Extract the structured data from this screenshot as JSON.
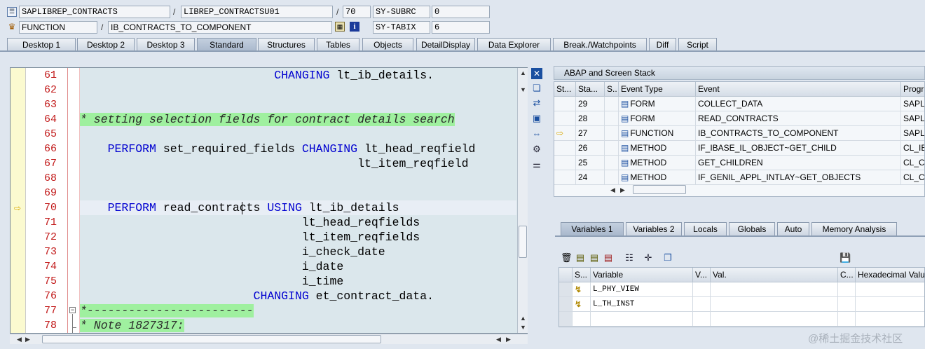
{
  "header": {
    "row1": {
      "program": "SAPLIBREP_CONTRACTS",
      "include": "LIBREP_CONTRACTSU01",
      "line": "70",
      "sysvar_name": "SY-SUBRC",
      "sysvar_value": "0"
    },
    "row2": {
      "type": "FUNCTION",
      "name": "IB_CONTRACTS_TO_COMPONENT",
      "sysvar_name": "SY-TABIX",
      "sysvar_value": "6"
    }
  },
  "tabs": [
    "Desktop 1",
    "Desktop 2",
    "Desktop 3",
    "Standard",
    "Structures",
    "Tables",
    "Objects",
    "DetailDisplay",
    "Data Explorer",
    "Break./Watchpoints",
    "Diff",
    "Script"
  ],
  "active_tab": "Standard",
  "editor": {
    "current_line": "70",
    "lines": [
      {
        "num": "61",
        "parts": [
          {
            "t": "                            ",
            "c": ""
          },
          {
            "t": "CHANGING",
            "c": "kw"
          },
          {
            "t": " lt_ib_details.",
            "c": ""
          }
        ]
      },
      {
        "num": "62",
        "parts": []
      },
      {
        "num": "63",
        "parts": []
      },
      {
        "num": "64",
        "parts": [
          {
            "t": "* setting selection fields for contract details search",
            "c": "cm"
          }
        ]
      },
      {
        "num": "65",
        "parts": []
      },
      {
        "num": "66",
        "parts": [
          {
            "t": "    ",
            "c": ""
          },
          {
            "t": "PERFORM",
            "c": "kw"
          },
          {
            "t": " set_required_fields ",
            "c": ""
          },
          {
            "t": "CHANGING",
            "c": "kw"
          },
          {
            "t": " lt_head_reqfield",
            "c": ""
          }
        ]
      },
      {
        "num": "67",
        "parts": [
          {
            "t": "                                        lt_item_reqfield",
            "c": ""
          }
        ]
      },
      {
        "num": "68",
        "parts": []
      },
      {
        "num": "69",
        "parts": []
      },
      {
        "num": "70",
        "parts": [
          {
            "t": "    ",
            "c": ""
          },
          {
            "t": "PERFORM",
            "c": "kw"
          },
          {
            "t": " read_contracts ",
            "c": ""
          },
          {
            "t": "USING",
            "c": "kw"
          },
          {
            "t": " lt_ib_details",
            "c": ""
          }
        ]
      },
      {
        "num": "71",
        "parts": [
          {
            "t": "                                lt_head_reqfields",
            "c": ""
          }
        ]
      },
      {
        "num": "72",
        "parts": [
          {
            "t": "                                lt_item_reqfields",
            "c": ""
          }
        ]
      },
      {
        "num": "73",
        "parts": [
          {
            "t": "                                i_check_date",
            "c": ""
          }
        ]
      },
      {
        "num": "74",
        "parts": [
          {
            "t": "                                i_date",
            "c": ""
          }
        ]
      },
      {
        "num": "75",
        "parts": [
          {
            "t": "                                i_time",
            "c": ""
          }
        ]
      },
      {
        "num": "76",
        "parts": [
          {
            "t": "                         ",
            "c": ""
          },
          {
            "t": "CHANGING",
            "c": "kw"
          },
          {
            "t": " et_contract_data.",
            "c": ""
          }
        ]
      },
      {
        "num": "77",
        "parts": [
          {
            "t": "*------------------------",
            "c": "cm"
          }
        ]
      },
      {
        "num": "78",
        "parts": [
          {
            "t": "* Note 1827317:",
            "c": "cm"
          }
        ]
      }
    ]
  },
  "stack": {
    "title": "ABAP and Screen Stack",
    "columns": [
      "St...",
      "Sta...",
      "S..",
      "Event Type",
      "Event",
      "Progra"
    ],
    "rows": [
      {
        "level": "29",
        "type": "FORM",
        "event": "COLLECT_DATA",
        "program": "SAPLIE",
        "current": false
      },
      {
        "level": "28",
        "type": "FORM",
        "event": "READ_CONTRACTS",
        "program": "SAPLIE",
        "current": false
      },
      {
        "level": "27",
        "type": "FUNCTION",
        "event": "IB_CONTRACTS_TO_COMPONENT",
        "program": "SAPLIE",
        "current": true
      },
      {
        "level": "26",
        "type": "METHOD",
        "event": "IF_IBASE_IL_OBJECT~GET_CHILD",
        "program": "CL_IBC",
        "current": false
      },
      {
        "level": "25",
        "type": "METHOD",
        "event": "GET_CHILDREN",
        "program": "CL_CR",
        "current": false
      },
      {
        "level": "24",
        "type": "METHOD",
        "event": "IF_GENIL_APPL_INTLAY~GET_OBJECTS",
        "program": "CL_CR",
        "current": false
      }
    ]
  },
  "var_tabs": [
    "Variables 1",
    "Variables 2",
    "Locals",
    "Globals",
    "Auto",
    "Memory Analysis"
  ],
  "active_var_tab": "Variables 1",
  "variables": {
    "columns": [
      "S...",
      "Variable",
      "V...",
      "Val.",
      "C...",
      "Hexadecimal Value"
    ],
    "rows": [
      {
        "name": "L_PHY_VIEW"
      },
      {
        "name": "L_TH_INST"
      }
    ]
  },
  "watermark": "@稀土掘金技术社区",
  "colors": {
    "keyword": "#0000d0",
    "comment_bg": "#9ff09f",
    "line_number": "#c21a1a",
    "editor_bg": "#dbe7ec"
  }
}
